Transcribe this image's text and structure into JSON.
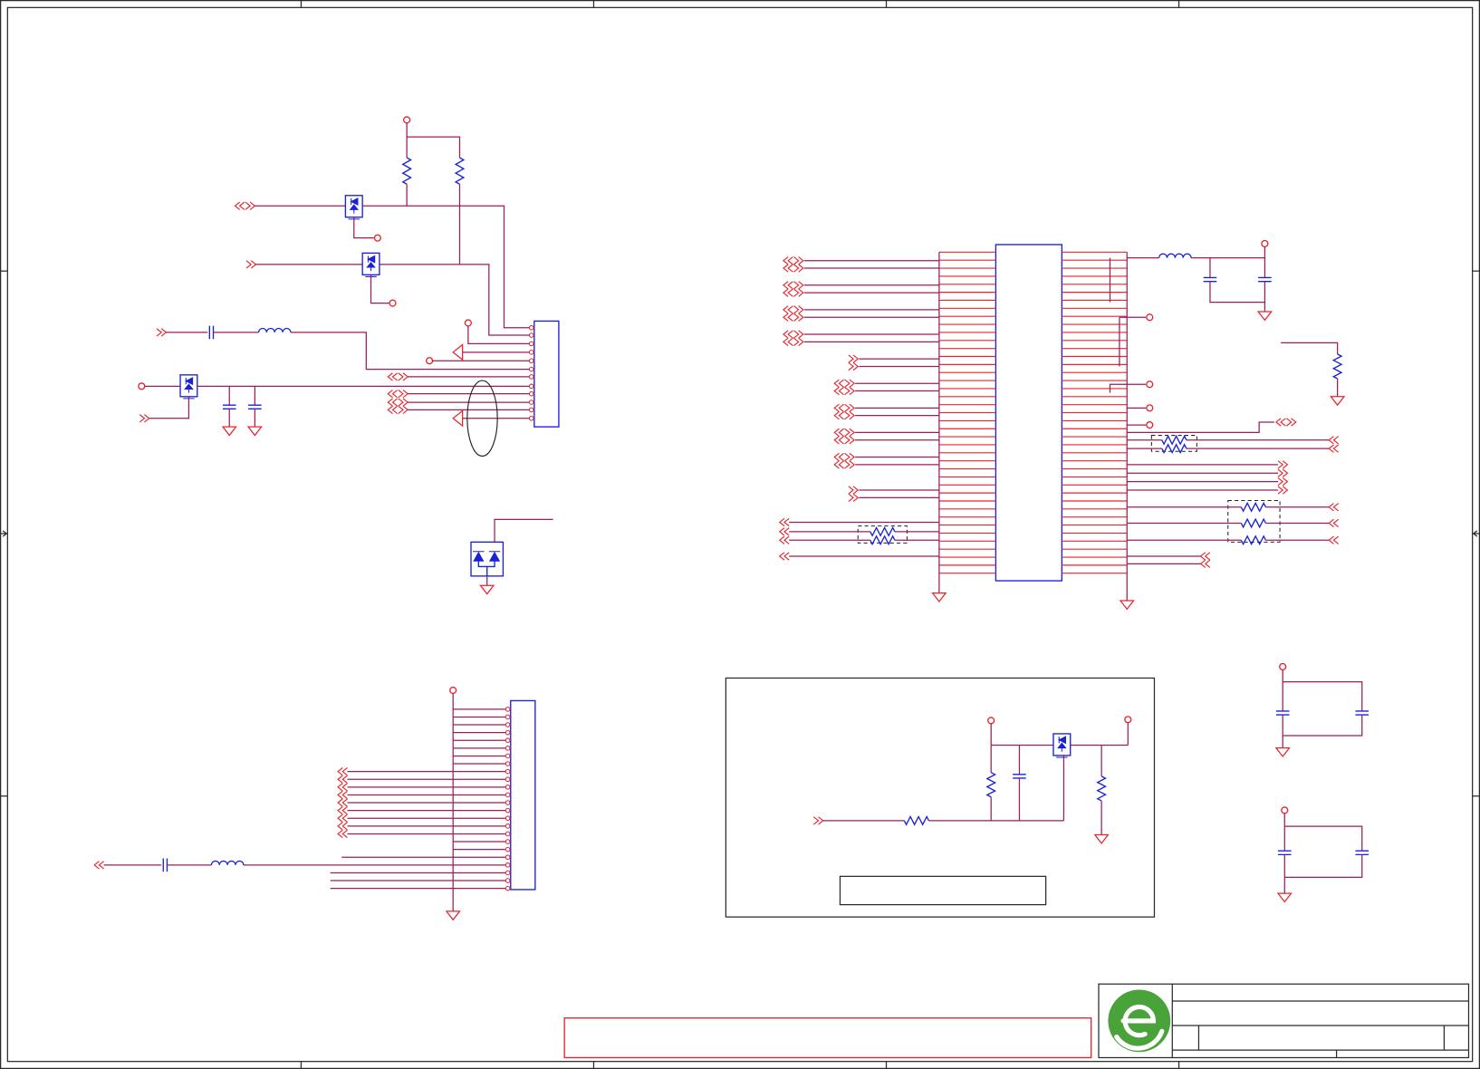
{
  "colors": {
    "background": "#ffffff",
    "frame": "#2a2a2a",
    "wire": "#9c1c5c",
    "pin": "#e8242c",
    "component": "#1a22d8",
    "logo": "#4aa23a"
  },
  "icons": {
    "logo": "company-logo-icon",
    "power_port": "power-port-icon",
    "ground": "ground-icon",
    "resistor": "resistor-icon",
    "capacitor": "capacitor-icon",
    "inductor": "inductor-icon",
    "transistor": "mosfet-icon",
    "diode": "tvs-diode-icon",
    "off_page_connector": "off-page-arrow-icon"
  }
}
